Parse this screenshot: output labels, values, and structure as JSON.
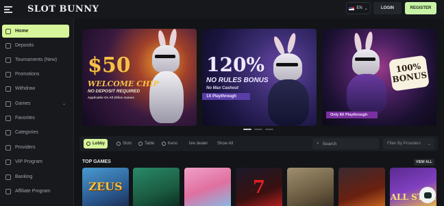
{
  "header": {
    "logo": "SLOT BUNNY",
    "language": "EN",
    "login_label": "LOGIN",
    "register_label": "REGISTER"
  },
  "sidebar": {
    "items": [
      {
        "label": "Home",
        "icon": "home-icon",
        "active": true
      },
      {
        "label": "Deposits",
        "icon": "wallet-icon"
      },
      {
        "label": "Tournaments (New)",
        "icon": "trophy-icon"
      },
      {
        "label": "Promotions",
        "icon": "gift-icon"
      },
      {
        "label": "Withdraw",
        "icon": "withdraw-icon"
      },
      {
        "label": "Games",
        "icon": "gamepad-icon",
        "expandable": true
      },
      {
        "label": "Favorites",
        "icon": "heart-icon"
      },
      {
        "label": "Categories",
        "icon": "grid-icon"
      },
      {
        "label": "Providers",
        "icon": "provider-icon"
      },
      {
        "label": "VIP Program",
        "icon": "crown-icon"
      },
      {
        "label": "Banking",
        "icon": "bank-icon"
      },
      {
        "label": "Affiliate Program",
        "icon": "users-icon"
      }
    ]
  },
  "banners": {
    "b1": {
      "amount": "$50",
      "title": "WELCOME CHIP",
      "line1": "NO DEPOSIT REQUIRED",
      "line2": "Applicable On All Zillion Games"
    },
    "b2": {
      "amount": "120%",
      "title": "NO RULES BONUS",
      "line1": "No Max Cashout",
      "line2": "1X Playthrough"
    },
    "b3": {
      "badge": "100% BONUS",
      "line1": "Only 8X Playthrough"
    }
  },
  "filters": {
    "tabs": [
      {
        "label": "Lobby",
        "active": true
      },
      {
        "label": "Slots"
      },
      {
        "label": "Table"
      },
      {
        "label": "Keno"
      },
      {
        "label": "live dealer"
      },
      {
        "label": "Show All"
      }
    ],
    "search_placeholder": "Search",
    "provider_placeholder": "Filter By Providers"
  },
  "section": {
    "title": "TOP GAMES",
    "view_all": "VIEW ALL"
  },
  "games": [
    "ZEUS",
    "",
    "",
    "7",
    "",
    "",
    "ALL STAR"
  ]
}
